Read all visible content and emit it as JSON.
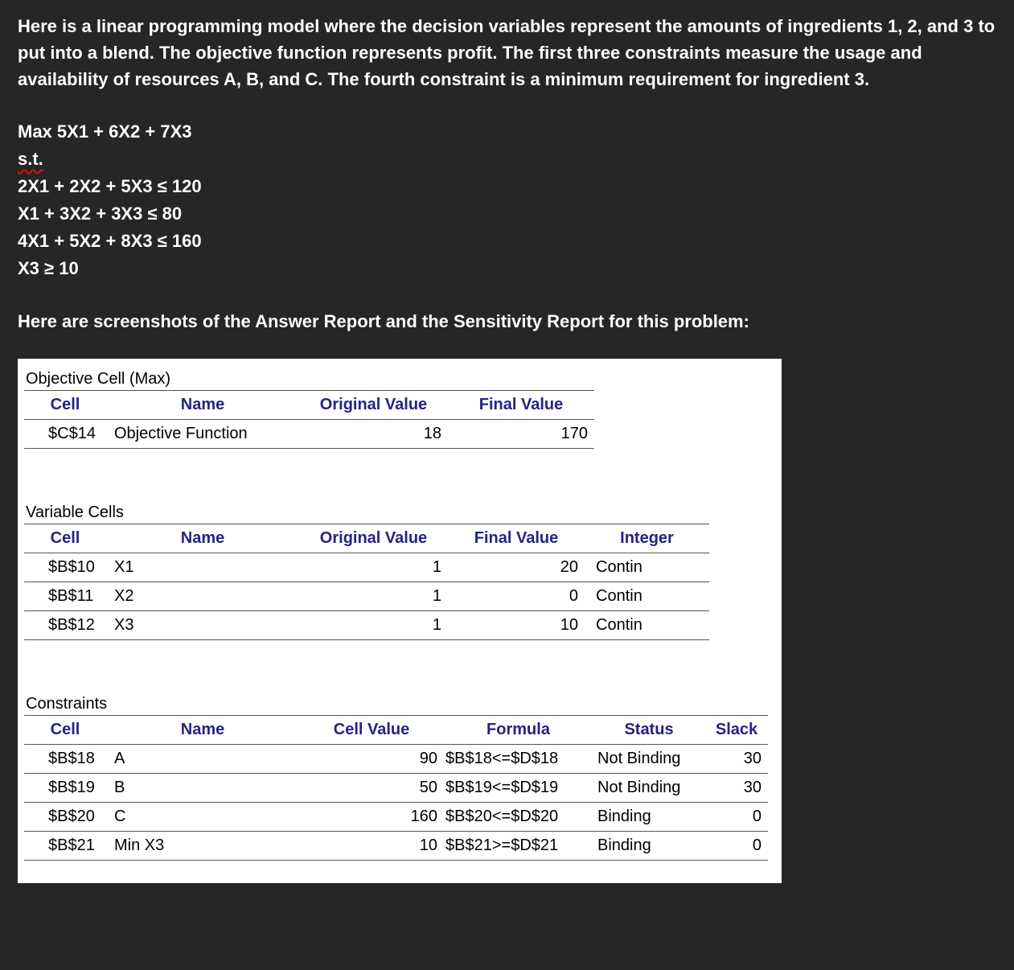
{
  "colors": {
    "background": "#262626",
    "body_text": "#ffffff",
    "panel_background": "#ffffff",
    "table_header_text": "#232388",
    "table_body_text": "#000000",
    "rule_line": "#555555",
    "squiggle_red": "#e01010"
  },
  "intro": {
    "paragraph": "Here is a linear programming model where the decision variables represent the amounts of ingredients 1, 2, and 3 to put into a blend. The objective function represents profit. The first three constraints measure the usage and availability of resources A, B, and C. The fourth constraint is a minimum requirement for ingredient 3.",
    "reports_line": "Here are screenshots of the Answer Report and the Sensitivity Report for this problem:"
  },
  "model": {
    "objective": "Max 5X1 + 6X2 + 7X3",
    "st": "s.t.",
    "constraints": [
      "2X1 + 2X2 + 5X3 ≤ 120",
      "X1 + 3X2 + 3X3 ≤ 80",
      "4X1 + 5X2 + 8X3 ≤ 160",
      "X3 ≥ 10"
    ]
  },
  "report": {
    "objective_section": {
      "title": "Objective Cell (Max)",
      "headers": [
        "Cell",
        "Name",
        "Original Value",
        "Final Value"
      ],
      "rows": [
        [
          "$C$14",
          "Objective Function",
          "18",
          "170"
        ]
      ]
    },
    "variable_section": {
      "title": "Variable Cells",
      "headers": [
        "Cell",
        "Name",
        "Original Value",
        "Final Value",
        "Integer"
      ],
      "rows": [
        [
          "$B$10",
          "X1",
          "1",
          "20",
          "Contin"
        ],
        [
          "$B$11",
          "X2",
          "1",
          "0",
          "Contin"
        ],
        [
          "$B$12",
          "X3",
          "1",
          "10",
          "Contin"
        ]
      ]
    },
    "constraints_section": {
      "title": "Constraints",
      "headers": [
        "Cell",
        "Name",
        "Cell Value",
        "Formula",
        "Status",
        "Slack"
      ],
      "rows": [
        [
          "$B$18",
          "A",
          "90",
          "$B$18<=$D$18",
          "Not Binding",
          "30"
        ],
        [
          "$B$19",
          "B",
          "50",
          "$B$19<=$D$19",
          "Not Binding",
          "30"
        ],
        [
          "$B$20",
          "C",
          "160",
          "$B$20<=$D$20",
          "Binding",
          "0"
        ],
        [
          "$B$21",
          "Min X3",
          "10",
          "$B$21>=$D$21",
          "Binding",
          "0"
        ]
      ]
    }
  }
}
